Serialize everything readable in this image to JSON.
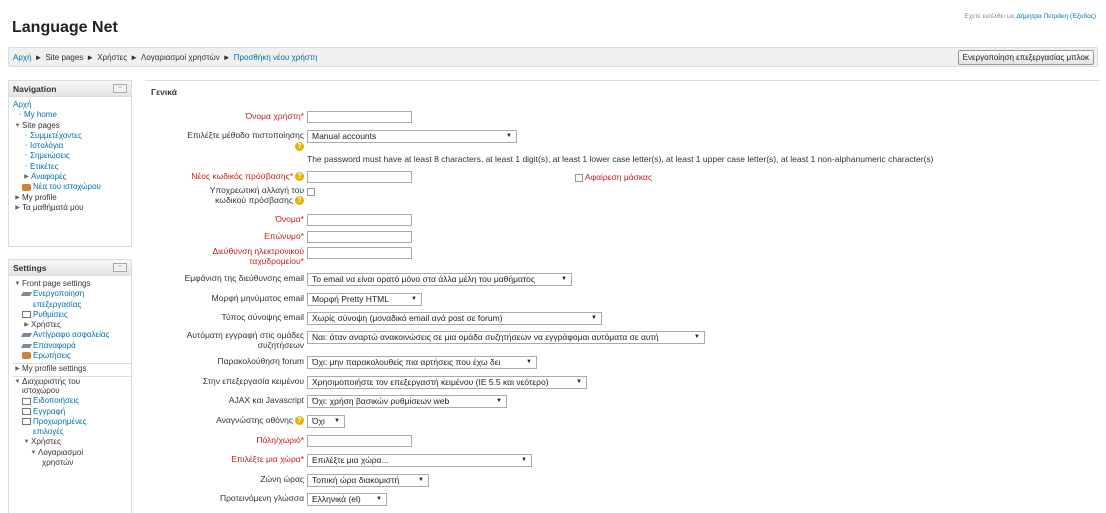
{
  "header": {
    "site_title": "Language Net",
    "login_prefix": "Έχετε εισέλθει ως",
    "user_name": "Δήμητρα Πετράκη",
    "logout_label": "(Έξοδος)"
  },
  "breadcrumb": {
    "sep": "►",
    "items": [
      "Αρχή",
      "Site pages",
      "Χρήστες",
      "Λογαριασμοί χρηστών",
      "Προσθήκη νέου χρήστη"
    ]
  },
  "edit_button": "Ενεργοποίηση επεξεργασίας μπλοκ",
  "navigation": {
    "title": "Navigation",
    "items": [
      {
        "label": "Αρχή",
        "glyph": ""
      },
      {
        "label": "My home",
        "glyph": "▫"
      },
      {
        "label": "Site pages",
        "glyph": "▼"
      },
      {
        "label": "Συμμετέχοντες",
        "glyph": "▫"
      },
      {
        "label": "Ιστολόγια",
        "glyph": "▫"
      },
      {
        "label": "Σημειώσεις",
        "glyph": "▫"
      },
      {
        "label": "Ετικέτες",
        "glyph": "▫"
      },
      {
        "label": "Αναφορές",
        "glyph": "▶"
      },
      {
        "label": "Νέα του ιστοχώρου",
        "glyph": ""
      },
      {
        "label": "My profile",
        "glyph": "▶"
      },
      {
        "label": "Τα μαθήματά μου",
        "glyph": "▶"
      }
    ]
  },
  "settings": {
    "title": "Settings",
    "items": [
      {
        "label": "Front page settings",
        "glyph": "▼"
      },
      {
        "label": "Ενεργοποίηση",
        "glyph": ""
      },
      {
        "label": "επεξεργασίας",
        "glyph": ""
      },
      {
        "label": "Ρυθμίσεις",
        "glyph": ""
      },
      {
        "label": "Χρήστες",
        "glyph": "▶"
      },
      {
        "label": "Αντίγραφο ασφαλείας",
        "glyph": ""
      },
      {
        "label": "Επαναφορά",
        "glyph": ""
      },
      {
        "label": "Ερωτήσεις",
        "glyph": ""
      },
      {
        "label": "My profile settings",
        "glyph": "▶"
      },
      {
        "label": "Διαχειριστής του",
        "glyph": "▼"
      },
      {
        "label": "ιστοχώρου",
        "glyph": ""
      },
      {
        "label": "Ειδοποιήσεις",
        "glyph": ""
      },
      {
        "label": "Εγγραφή",
        "glyph": ""
      },
      {
        "label": "Προχωρημένες",
        "glyph": ""
      },
      {
        "label": "επιλογές",
        "glyph": ""
      },
      {
        "label": "Χρήστες",
        "glyph": "▼"
      },
      {
        "label": "Λογαριασμοί",
        "glyph": "▼"
      },
      {
        "label": "χρηστών",
        "glyph": ""
      }
    ]
  },
  "form": {
    "legend": "Γενικά",
    "help_glyph": "?",
    "dropdown_glyph": "▼",
    "username_label": "Όνομα χρήστη*",
    "auth_label": "Επιλέξτε μέθοδο πιστοποίησης",
    "auth_value": "Manual accounts",
    "password_hint": "The password must have at least 8 characters, at least 1 digit(s), at least 1 lower case letter(s), at least 1 upper case letter(s), at least 1 non-alphanumeric character(s)",
    "new_password_label": "Νέος κωδικός πρόσβασης*",
    "unmask_label": "Αφαίρεση μάσκας",
    "force_change_label_1": "Υποχρεωτική αλλαγή του",
    "force_change_label_2": "κωδικού πρόσβασης",
    "firstname_label": "Όνομα*",
    "lastname_label": "Επώνυμο*",
    "email_label_1": "Διεύθυνση ηλεκτρονικού",
    "email_label_2": "ταχυδρομείου*",
    "email_display_label": "Εμφάνιση της διεύθυνσης email",
    "email_display_value": "Το email να είναι ορατό μόνο στα άλλα μέλη του μαθήματος",
    "email_format_label": "Μορφή μηνύματος email",
    "email_format_value": "Μορφή Pretty HTML",
    "digest_label": "Τύπος σύνοψης email",
    "digest_value": "Χωρίς σύνοψη (μοναδικό email ανά post σε forum)",
    "autosub_label_1": "Αυτόματη εγγραφή στις ομάδες",
    "autosub_label_2": "συζητήσεων",
    "autosub_value": "Ναι: όταν αναρτώ ανακοινώσεις σε μια ομάδα συζητήσεων να εγγράφομαι αυτόματα σε αυτή",
    "tracking_label": "Παρακολούθηση forum",
    "tracking_value": "Όχι: μην παρακολουθείς πια αρτήσεις που έχω δει",
    "editor_label": "Στην επεξεργασία κειμένου",
    "editor_value": "Χρησιμοποιήστε τον επεξεργαστή κειμένου (IE 5.5 και νεότερο)",
    "ajax_label": "AJAX και Javascript",
    "ajax_value": "Όχι: χρήση βασικών ρυθμίσεων web",
    "screenreader_label": "Αναγνώστης οθόνης",
    "screenreader_value": "Όχι",
    "city_label": "Πόλη/χωριό*",
    "country_label": "Επιλέξτε μια χώρα*",
    "country_value": "Επιλέξτε μια χώρα...",
    "timezone_label": "Ζώνη ώρας",
    "timezone_value": "Τοπική ώρα διακομιστή",
    "lang_label": "Προτεινόμενη γλώσσα",
    "lang_value": "Ελληνικά (el)"
  },
  "colors": {
    "link": "#0070a8",
    "required": "#c41c1c",
    "help_icon": "#e5b300"
  }
}
